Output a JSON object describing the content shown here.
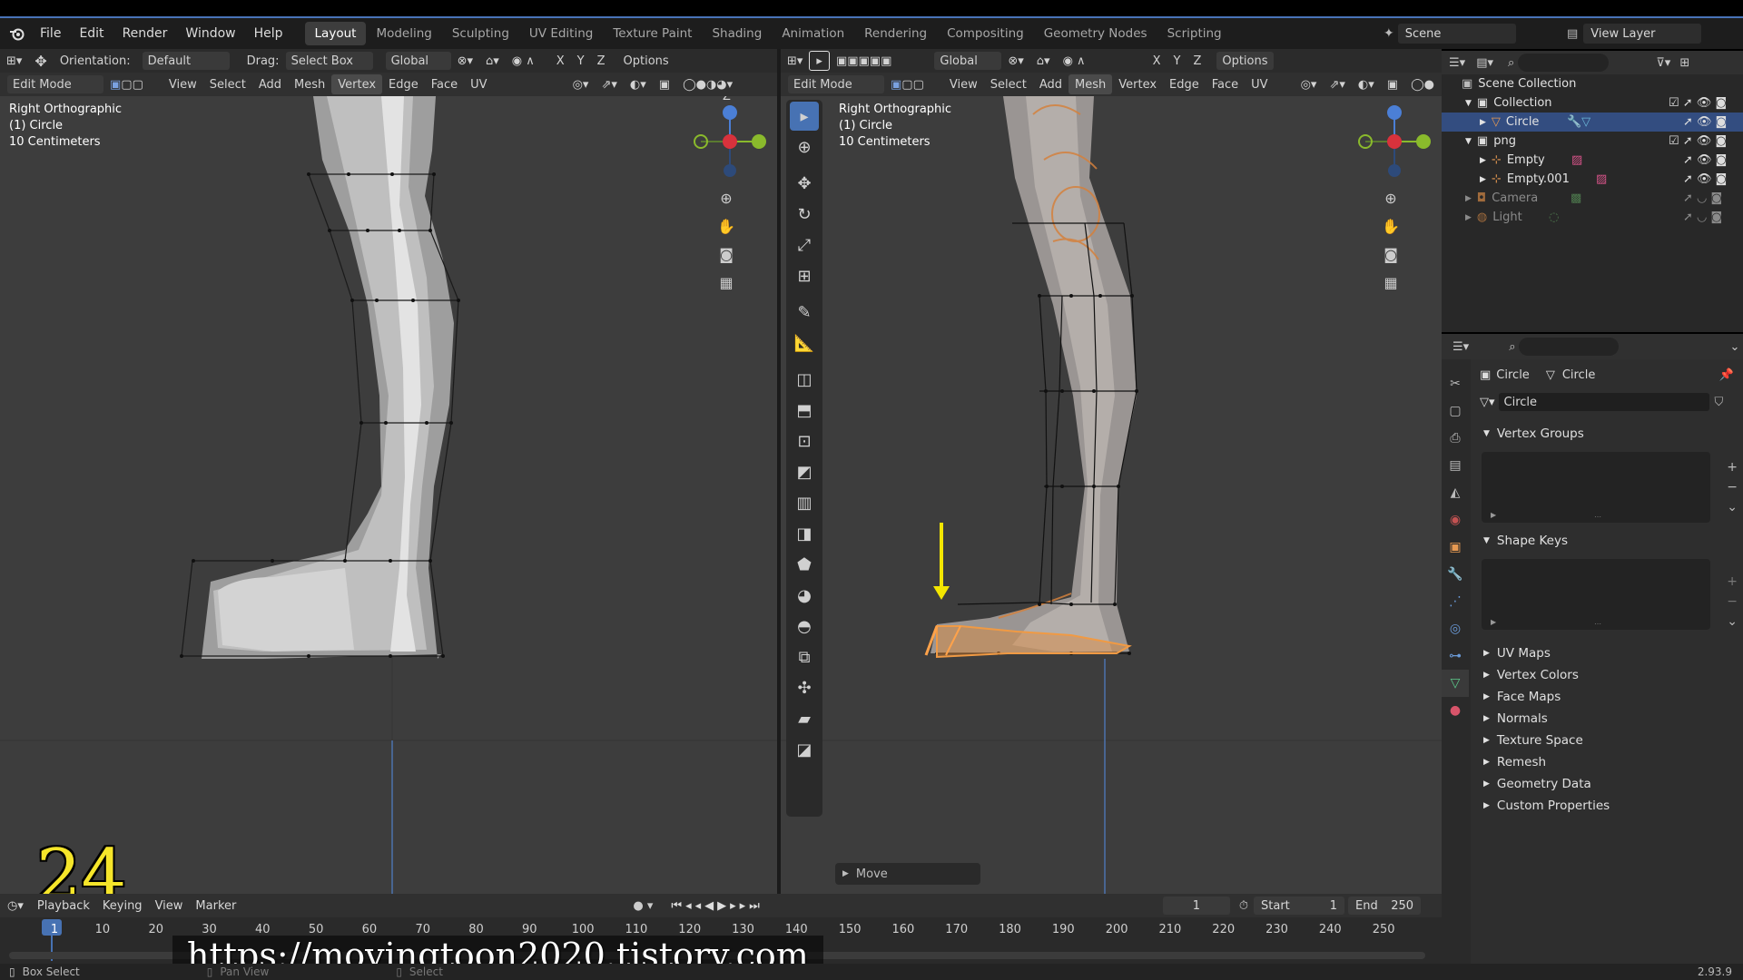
{
  "app": {
    "menu": [
      "File",
      "Edit",
      "Render",
      "Window",
      "Help"
    ],
    "workspaces": [
      "Layout",
      "Modeling",
      "Sculpting",
      "UV Editing",
      "Texture Paint",
      "Shading",
      "Animation",
      "Rendering",
      "Compositing",
      "Geometry Nodes",
      "Scripting"
    ],
    "active_workspace": "Layout",
    "scene": "Scene",
    "view_layer": "View Layer",
    "version": "2.93.9"
  },
  "left_header": {
    "orientation_label": "Orientation:",
    "orientation_value": "Default",
    "drag_label": "Drag:",
    "drag_value": "Select Box",
    "transform_space": "Global",
    "axes": [
      "X",
      "Y",
      "Z"
    ],
    "options": "Options"
  },
  "right_header": {
    "transform_space": "Global",
    "axes": [
      "X",
      "Y",
      "Z"
    ],
    "options": "Options"
  },
  "editmode_menu": {
    "mode": "Edit Mode",
    "items": [
      "View",
      "Select",
      "Add",
      "Mesh",
      "Vertex",
      "Edge",
      "Face",
      "UV"
    ]
  },
  "left_viewport": {
    "view_name": "Right Orthographic",
    "object": "(1) Circle",
    "scale": "10 Centimeters"
  },
  "right_viewport": {
    "view_name": "Right Orthographic",
    "object": "(1) Circle",
    "scale": "10 Centimeters",
    "last_op": "Move"
  },
  "gizmo": {
    "z": "Z",
    "x": "X",
    "y": "Y"
  },
  "outliner": {
    "scene_collection": "Scene Collection",
    "rows": [
      {
        "label": "Collection",
        "indent": 1
      },
      {
        "label": "Circle",
        "indent": 2
      },
      {
        "label": "png",
        "indent": 1
      },
      {
        "label": "Empty",
        "indent": 2
      },
      {
        "label": "Empty.001",
        "indent": 2
      },
      {
        "label": "Camera",
        "indent": 1
      },
      {
        "label": "Light",
        "indent": 1
      }
    ]
  },
  "properties": {
    "breadcrumb_object": "Circle",
    "breadcrumb_data": "Circle",
    "data_name": "Circle",
    "open_panels": [
      "Vertex Groups",
      "Shape Keys"
    ],
    "closed_panels": [
      "UV Maps",
      "Vertex Colors",
      "Face Maps",
      "Normals",
      "Texture Space",
      "Remesh",
      "Geometry Data",
      "Custom Properties"
    ]
  },
  "timeline": {
    "menu": [
      "Playback",
      "Keying",
      "View",
      "Marker"
    ],
    "current_frame": "1",
    "start_label": "Start",
    "start_value": "1",
    "end_label": "End",
    "end_value": "250",
    "ticks": [
      "1",
      "10",
      "20",
      "30",
      "40",
      "50",
      "60",
      "70",
      "80",
      "90",
      "100",
      "110",
      "120",
      "130",
      "140",
      "150",
      "160",
      "170",
      "180",
      "190",
      "200",
      "210",
      "220",
      "230",
      "240",
      "250"
    ]
  },
  "status": {
    "left": "Box Select",
    "middle": "Pan View",
    "right": "Select"
  },
  "overlay": {
    "number": "24",
    "url": "https://movingtoon2020.tistory.com"
  },
  "colors": {
    "accent": "#4772b3",
    "arrow": "#f3e600",
    "selected_edge": "#e58a36"
  }
}
